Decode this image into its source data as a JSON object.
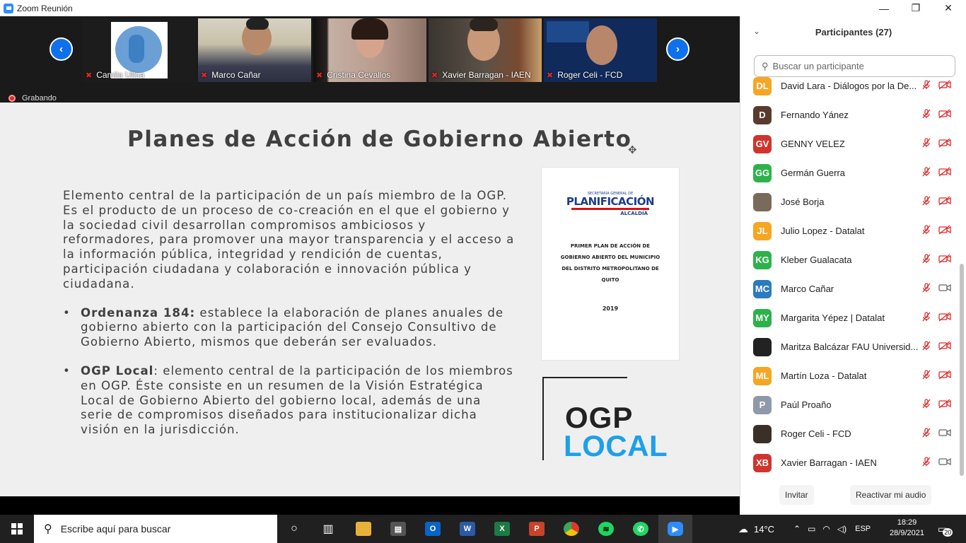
{
  "window": {
    "title": "Zoom Reunión",
    "minimize": "—",
    "restore": "❐",
    "close": "✕"
  },
  "strip": {
    "prev": "‹",
    "next": "›",
    "tiles": [
      {
        "name": "Camila Ulloa"
      },
      {
        "name": "Marco Cañar"
      },
      {
        "name": "Cristina Cevallos"
      },
      {
        "name": "Xavier Barragan - IAEN"
      },
      {
        "name": "Roger Celi - FCD"
      }
    ],
    "recording": "Grabando"
  },
  "slide": {
    "title": "Planes de Acción de Gobierno Abierto",
    "paragraph": "Elemento central de la participación de un país miembro de la OGP. Es el producto de un proceso de co-creación en el que el gobierno y la sociedad civil desarrollan compromisos ambiciosos y reformadores, para promover una mayor transparencia y el acceso a la información pública, integridad y rendición de cuentas, participación ciudadana y colaboración e innovación pública y ciudadana.",
    "bullets": [
      {
        "bold": "Ordenanza 184:",
        "text": " establece la elaboración de planes anuales de gobierno abierto con la participación del Consejo Consultivo de Gobierno Abierto, mismos que deberán ser evaluados."
      },
      {
        "bold": "OGP Local",
        "text": ": elemento central de la participación de los miembros en OGP. Éste consiste en un resumen de la Visión Estratégica Local de Gobierno Abierto del gobierno local, además de una serie de compromisos diseñados para institucionalizar dicha visión en la jurisdicción."
      }
    ],
    "doc": {
      "org_small": "SECRETARÍA GENERAL DE",
      "org_big": "PLANIFICACIÓN",
      "org_sub": "ALCALDÍA",
      "plan": "PRIMER PLAN DE ACCIÓN DE GOBIERNO ABIERTO DEL MUNICIPIO DEL DISTRITO METROPOLITANO DE QUITO",
      "year": "2019"
    },
    "logo": {
      "line1": "OGP",
      "line2": "LOCAL"
    }
  },
  "panel": {
    "title": "Participantes (27)",
    "search_placeholder": "Buscar un participante",
    "participants": [
      {
        "initials": "DL",
        "name": "David Lara - Diálogos por la De...",
        "color": "#f5a623",
        "video": false
      },
      {
        "initials": "D",
        "name": "Fernando Yánez",
        "color": "#5b3a2e",
        "video": false
      },
      {
        "initials": "GV",
        "name": "GENNY VELEZ",
        "color": "#d0342c",
        "video": false
      },
      {
        "initials": "GG",
        "name": "Germán Guerra",
        "color": "#2db24a",
        "video": false
      },
      {
        "initials": "",
        "name": "José Borja",
        "color": "#7a6a5a",
        "video": false,
        "photo": true
      },
      {
        "initials": "JL",
        "name": "Julio Lopez - Datalat",
        "color": "#f5a623",
        "video": false
      },
      {
        "initials": "KG",
        "name": "Kleber Gualacata",
        "color": "#2db24a",
        "video": false
      },
      {
        "initials": "MC",
        "name": "Marco Cañar",
        "color": "#2b7bc0",
        "video": true
      },
      {
        "initials": "MY",
        "name": "Margarita Yépez | Datalat",
        "color": "#2db24a",
        "video": false
      },
      {
        "initials": "",
        "name": "Maritza Balcázar FAU Universid...",
        "color": "#222222",
        "video": false,
        "photo": true
      },
      {
        "initials": "ML",
        "name": "Martín Loza - Datalat",
        "color": "#f5a623",
        "video": false
      },
      {
        "initials": "P",
        "name": "Paúl Proaño",
        "color": "#8e9aa8",
        "video": false
      },
      {
        "initials": "",
        "name": "Roger Celi - FCD",
        "color": "#3a3028",
        "video": true,
        "photo": true
      },
      {
        "initials": "XB",
        "name": "Xavier Barragan - IAEN",
        "color": "#d0342c",
        "video": true
      }
    ],
    "invite": "Invitar",
    "unmute": "Reactivar mi audio"
  },
  "taskbar": {
    "search_text": "Escribe aquí para buscar",
    "weather": "14°C",
    "lang": "ESP",
    "time": "18:29",
    "date": "28/9/2021",
    "notif": "20"
  }
}
